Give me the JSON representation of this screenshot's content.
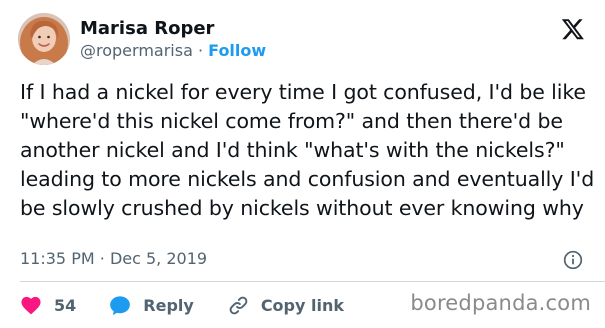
{
  "author": {
    "name": "Marisa Roper",
    "handle": "@ropermarisa",
    "separator": "·",
    "follow_label": "Follow"
  },
  "tweet": {
    "text": "If I had a nickel for every time I got confused, I'd be like \"where'd this nickel come from?\" and then there'd be another nickel and I'd think \"what's with the nickels?\" leading to more nickels and confusion and eventually I'd be slowly crushed by nickels without ever knowing why",
    "time": "11:35 PM",
    "date_separator": "·",
    "date": "Dec 5, 2019"
  },
  "actions": {
    "likes_count": "54",
    "reply_label": "Reply",
    "copy_link_label": "Copy link"
  },
  "icons": {
    "platform": "x-logo-icon",
    "info": "info-icon",
    "like": "heart-icon",
    "reply": "speech-bubble-icon",
    "copy": "link-icon"
  },
  "colors": {
    "accent": "#1d9bf0",
    "like": "#f91880",
    "text": "#0f1419",
    "muted": "#536471"
  },
  "watermark": "boredpanda.com"
}
